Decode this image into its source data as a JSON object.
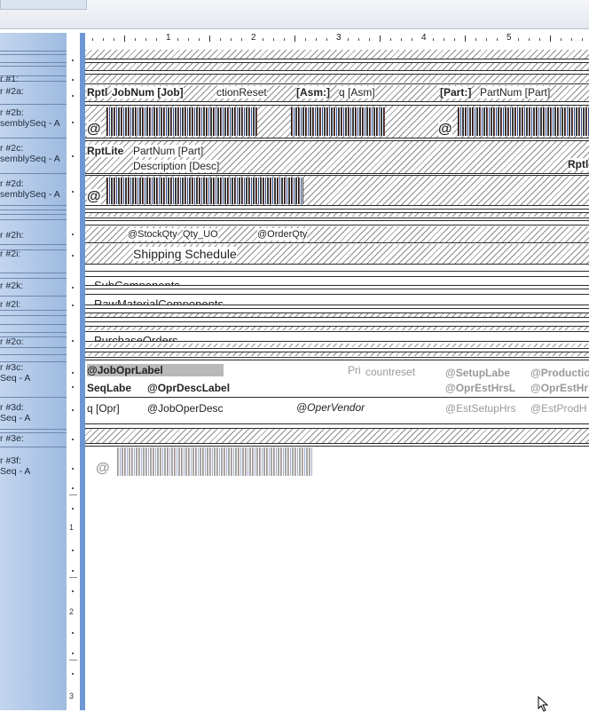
{
  "sidebar": {
    "sections": [
      {
        "label": "",
        "lines": [
          "r #1:"
        ]
      },
      {
        "label": "",
        "lines": [
          "r #2a:"
        ]
      },
      {
        "label": "",
        "lines": [
          "r #2b:",
          "semblySeq - A"
        ]
      },
      {
        "label": "",
        "lines": [
          "r #2c:",
          "semblySeq - A"
        ]
      },
      {
        "label": "",
        "lines": [
          "r #2d:",
          "semblySeq - A"
        ]
      },
      {
        "label": "",
        "lines": [
          "r #2h:"
        ]
      },
      {
        "label": "",
        "lines": [
          "r #2i:"
        ]
      },
      {
        "label": "",
        "lines": [
          "r #2k:"
        ]
      },
      {
        "label": "",
        "lines": [
          "r #2l:"
        ]
      },
      {
        "label": "",
        "lines": [
          "r #2o:"
        ]
      },
      {
        "label": "",
        "lines": [
          "r #3c:",
          "Seq - A"
        ]
      },
      {
        "label": "",
        "lines": [
          "r #3d:",
          "Seq - A"
        ]
      },
      {
        "label": "",
        "lines": [
          "r #3e:"
        ]
      },
      {
        "label": "",
        "lines": [
          "r #3f:",
          "Seq - A"
        ]
      }
    ]
  },
  "ruler": {
    "h_numbers": [
      "1",
      "2",
      "3",
      "4",
      "5"
    ],
    "v_numbers": [
      "1",
      "2",
      "3"
    ]
  },
  "report": {
    "band_2a": {
      "f1": "Rptl",
      "f2": "JobNum [Job]",
      "f3": "ctionReset",
      "f4": "[Asm:]",
      "f5": "q [Asm]",
      "f6": "[Part:]",
      "f7": "PartNum [Part]"
    },
    "band_2b": {
      "at": "@"
    },
    "band_2c": {
      "f1": "RptLite",
      "f2": "PartNum [Part]",
      "f3": "Description [Desc]",
      "f4": "Rptl"
    },
    "band_2d": {
      "at": "@"
    },
    "band_2h": {
      "f1": "@StockQty",
      "f2": "Qty_UO",
      "f3": "@OrderQty"
    },
    "band_2i": {
      "title": "Shipping Schedule"
    },
    "band_2k": {
      "title": "SubComponents"
    },
    "band_2l": {
      "title": "RawMaterialComponents"
    },
    "band_2o": {
      "title": "PurchaseOrders"
    },
    "band_3c": {
      "f1": "@JobOprLabel",
      "f2": "SeqLabe",
      "f3": "@OprDescLabel",
      "f4": "Pri",
      "f5": "countreset",
      "f6": "@SetupLabe",
      "f7": "@OprEstHrsL",
      "f8": "@Productio",
      "f9": "@OprEstHr"
    },
    "band_3d": {
      "f1": "q [Opr]",
      "f2": "@JobOperDesc",
      "f3": "@OperVendor",
      "f4": "@EstSetupHrs",
      "f5": "@EstProdH"
    },
    "band_3f": {
      "at": "@"
    }
  }
}
